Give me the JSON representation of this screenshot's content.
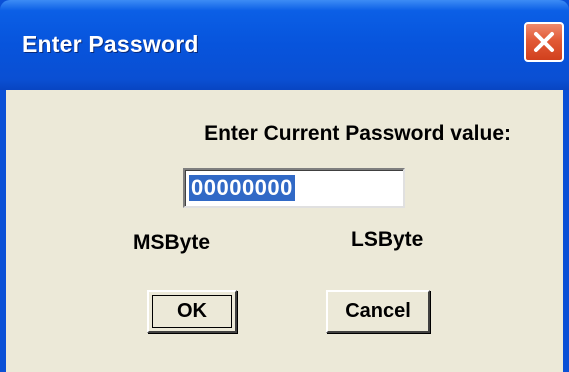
{
  "window": {
    "title": "Enter Password"
  },
  "dialog": {
    "prompt": "Enter Current Password value:",
    "password_value": "00000000",
    "msbyte_label": "MSByte",
    "lsbyte_label": "LSByte",
    "ok_label": "OK",
    "cancel_label": "Cancel"
  },
  "icons": {
    "close": "close-icon"
  },
  "colors": {
    "titlebar": "#0754dc",
    "close_button": "#e25a36",
    "client_background": "#ece9d8",
    "selection": "#3169c6"
  }
}
